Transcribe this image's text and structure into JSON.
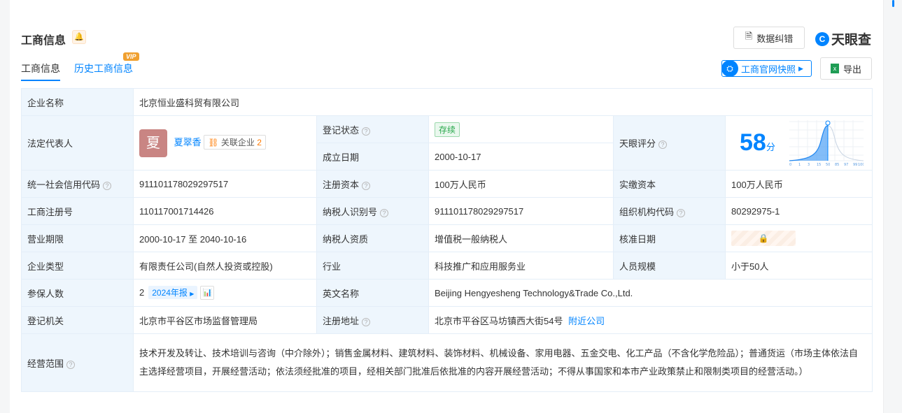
{
  "header": {
    "title": "工商信息",
    "correction_label": "数据纠错",
    "logo": "天眼查",
    "snapshot_label": "工商官网快照",
    "export_label": "导出"
  },
  "tabs": [
    {
      "label": "工商信息"
    },
    {
      "label": "历史工商信息",
      "badge": "VIP"
    }
  ],
  "rows": {
    "company_name": {
      "label": "企业名称",
      "value": "北京恒业盛科贸有限公司"
    },
    "legal_rep": {
      "label": "法定代表人",
      "avatar": "夏",
      "name": "夏翠香",
      "related_label": "关联企业",
      "related_count": "2"
    },
    "reg_status": {
      "label": "登记状态",
      "value": "存续"
    },
    "found_date": {
      "label": "成立日期",
      "value": "2000-10-17"
    },
    "score": {
      "label": "天眼评分",
      "value": "58",
      "unit": "分",
      "ticks": [
        "0",
        "1",
        "3",
        "15",
        "50",
        "85",
        "97",
        "99",
        "100"
      ]
    },
    "credit_code": {
      "label": "统一社会信用代码",
      "value": "911101178029297517"
    },
    "reg_capital": {
      "label": "注册资本",
      "value": "100万人民币"
    },
    "paid_capital": {
      "label": "实缴资本",
      "value": "100万人民币"
    },
    "reg_no": {
      "label": "工商注册号",
      "value": "110117001714426"
    },
    "taxpayer_id": {
      "label": "纳税人识别号",
      "value": "911101178029297517"
    },
    "org_code": {
      "label": "组织机构代码",
      "value": "80292975-1"
    },
    "term": {
      "label": "营业期限",
      "value": "2000-10-17 至 2040-10-16"
    },
    "taxpayer_qual": {
      "label": "纳税人资质",
      "value": "增值税一般纳税人"
    },
    "approve_date": {
      "label": "核准日期"
    },
    "type": {
      "label": "企业类型",
      "value": "有限责任公司(自然人投资或控股)"
    },
    "industry": {
      "label": "行业",
      "value": "科技推广和应用服务业"
    },
    "staff": {
      "label": "人员规模",
      "value": "小于50人"
    },
    "insured": {
      "label": "参保人数",
      "value": "2",
      "year": "2024年报"
    },
    "en_name": {
      "label": "英文名称",
      "value": "Beijing Hengyesheng Technology&Trade Co.,Ltd."
    },
    "authority": {
      "label": "登记机关",
      "value": "北京市平谷区市场监督管理局"
    },
    "address": {
      "label": "注册地址",
      "value": "北京市平谷区马坊镇西大街54号",
      "nearby": "附近公司"
    },
    "scope": {
      "label": "经营范围",
      "value": "技术开发及转让、技术培训与咨询（中介除外）；销售金属材料、建筑材料、装饰材料、机械设备、家用电器、五金交电、化工产品（不含化学危险品）；普通货运（市场主体依法自主选择经营项目，开展经营活动；依法须经批准的项目，经相关部门批准后依批准的内容开展经营活动；不得从事国家和本市产业政策禁止和限制类项目的经营活动。）"
    }
  }
}
